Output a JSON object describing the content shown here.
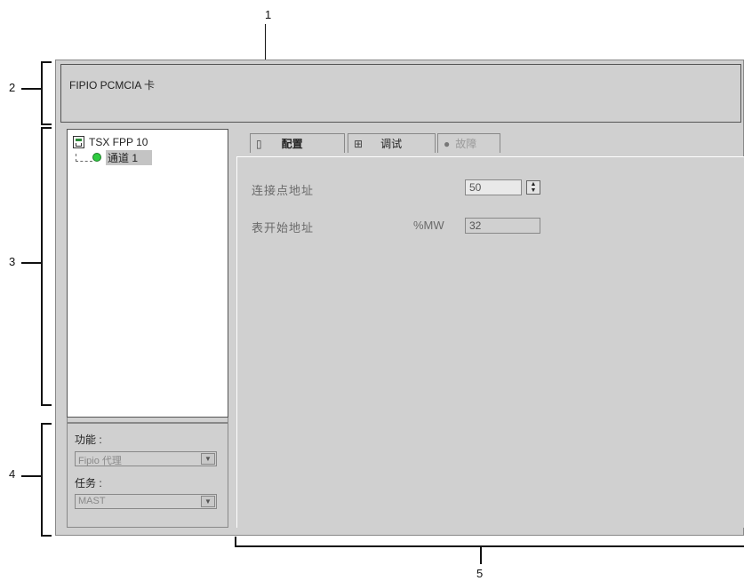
{
  "callouts": {
    "c1": "1",
    "c2": "2",
    "c3": "3",
    "c4": "4",
    "c5": "5"
  },
  "window": {
    "title": "FIPIO PCMCIA 卡"
  },
  "tree": {
    "device": "TSX FPP 10",
    "channel": "通道 1"
  },
  "lower_panel": {
    "function_label": "功能 :",
    "function_value": "Fipio 代理",
    "task_label": "任务 :",
    "task_value": "MAST"
  },
  "tabs": [
    {
      "label": "配置",
      "state": "active",
      "icon": "config-icon"
    },
    {
      "label": "调试",
      "state": "normal",
      "icon": "debug-icon"
    },
    {
      "label": "故障",
      "state": "disabled",
      "icon": "fault-icon"
    }
  ],
  "config": {
    "connection_point_label": "连接点地址",
    "connection_point_value": "50",
    "table_start_label": "表开始地址",
    "table_start_prefix": "%MW",
    "table_start_value": "32"
  },
  "colors": {
    "panel": "#d0d0d0",
    "status_green": "#2ecc40"
  }
}
